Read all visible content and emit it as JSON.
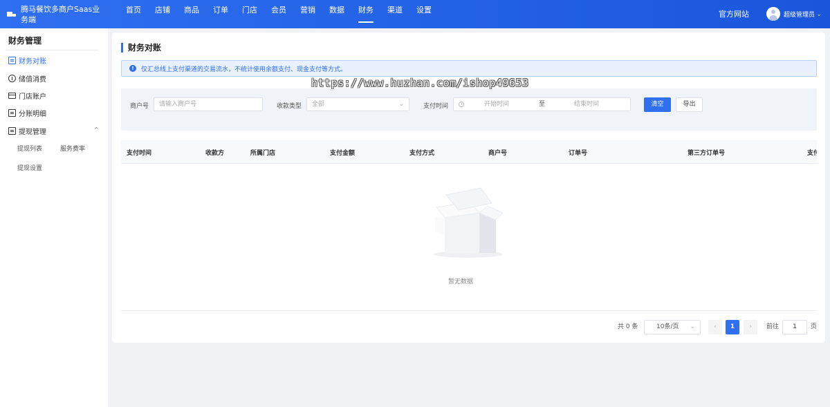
{
  "header": {
    "logo_text": "腾马餐饮多商户Saas业务端",
    "nav": [
      {
        "label": "首页"
      },
      {
        "label": "店铺"
      },
      {
        "label": "商品"
      },
      {
        "label": "订单"
      },
      {
        "label": "门店"
      },
      {
        "label": "会员"
      },
      {
        "label": "营销"
      },
      {
        "label": "数据"
      },
      {
        "label": "财务",
        "active": true
      },
      {
        "label": "渠道"
      },
      {
        "label": "设置"
      }
    ],
    "official_site": "官方网站",
    "user_name": "超级管理员",
    "user_caret": "⌄"
  },
  "sidebar": {
    "title": "财务管理",
    "items": [
      {
        "label": "财务对账",
        "icon": "receipt-icon",
        "active": true
      },
      {
        "label": "储值消费",
        "icon": "coin-icon"
      },
      {
        "label": "门店账户",
        "icon": "card-icon"
      },
      {
        "label": "分账明细",
        "icon": "receipt-icon"
      },
      {
        "label": "提现管理",
        "icon": "receipt-icon",
        "expanded": true
      }
    ],
    "expand_caret": "^",
    "sub_items": [
      {
        "label": "提现列表"
      },
      {
        "label": "服务费率"
      },
      {
        "label": "提现设置"
      }
    ]
  },
  "main": {
    "title": "财务对账",
    "alert": "仅汇总线上支付渠道的交易流水，不统计使用余额支付、现金支付等方式。",
    "filter": {
      "merchant_label": "商户号",
      "merchant_placeholder": "请输入商户号",
      "type_label": "收款类型",
      "type_value": "全部",
      "time_label": "支付时间",
      "start_placeholder": "开始时间",
      "separator": "至",
      "end_placeholder": "结束时间",
      "clear_label": "清空",
      "export_label": "导出"
    },
    "table": {
      "columns": [
        "支付时间",
        "收款方",
        "所属门店",
        "支付金额",
        "支付方式",
        "商户号",
        "订单号",
        "第三方订单号",
        "支付"
      ],
      "rows": [],
      "empty_text": "暂无数据"
    },
    "pagination": {
      "total": "共 0 条",
      "page_size": "10条/页",
      "prev": "‹",
      "current": "1",
      "next": "›",
      "goto_label": "前往",
      "goto_value": "1",
      "page_suffix": "页"
    }
  },
  "watermark": "https://www.huzhan.com/ishop49653",
  "colors": {
    "primary": "#2f6ff0",
    "header_bg": "#1a56db",
    "alert_bg": "#e8f1fd"
  }
}
